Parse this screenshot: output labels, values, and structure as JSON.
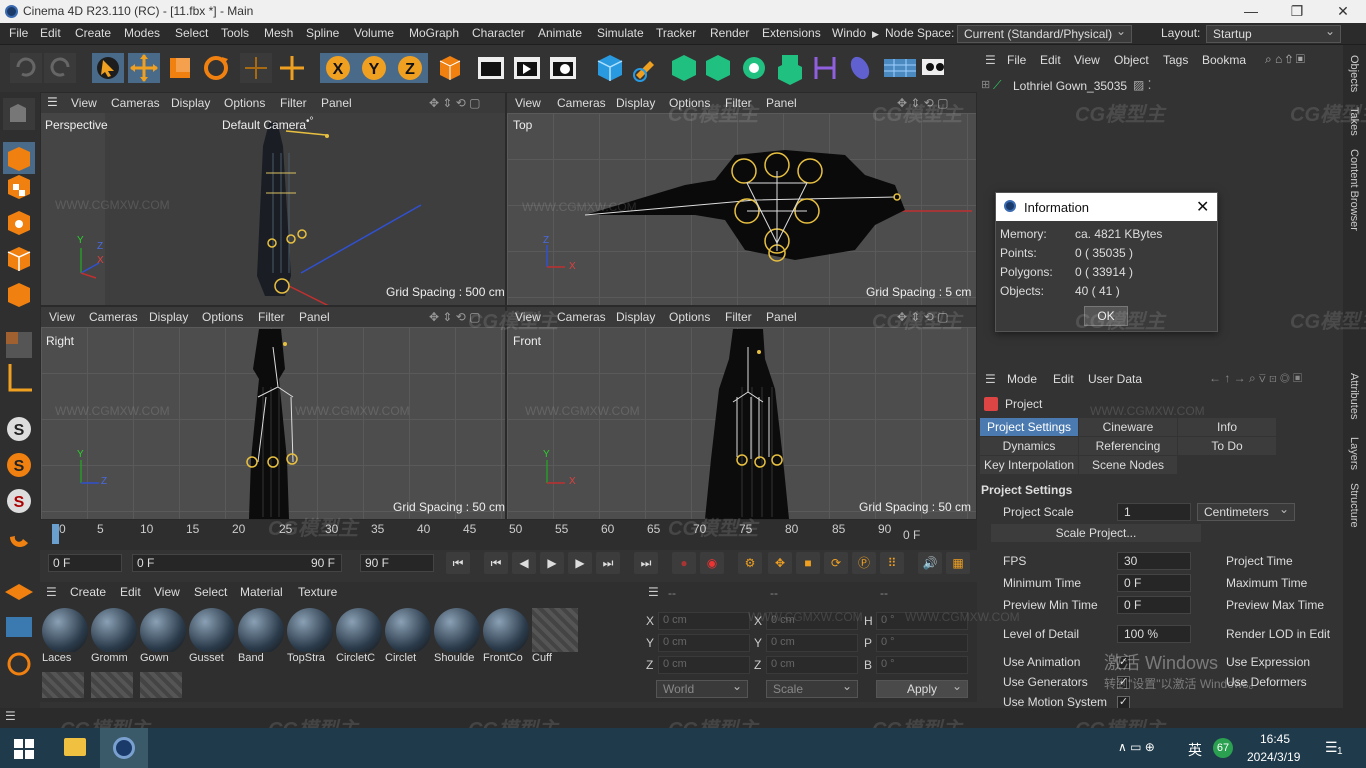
{
  "title_bar": {
    "title": "Cinema 4D R23.110 (RC) - [11.fbx *] - Main",
    "minimize": "—",
    "maximize": "❐",
    "close": "✕"
  },
  "menu": [
    "File",
    "Edit",
    "Create",
    "Modes",
    "Select",
    "Tools",
    "Mesh",
    "Spline",
    "Volume",
    "MoGraph",
    "Character",
    "Animate",
    "Simulate",
    "Tracker",
    "Render",
    "Extensions",
    "Windo"
  ],
  "node_space": {
    "label": "Node Space:",
    "value": "Current (Standard/Physical)"
  },
  "layout": {
    "label": "Layout:",
    "value": "Startup"
  },
  "viewport_menu": [
    "View",
    "Cameras",
    "Display",
    "Options",
    "Filter",
    "Panel"
  ],
  "viewports": {
    "perspective": {
      "name": "Perspective",
      "camera": "Default Camera",
      "camera_icon": "•°",
      "grid": "Grid Spacing : 500 cm"
    },
    "top": {
      "name": "Top",
      "grid": "Grid Spacing : 5 cm"
    },
    "right": {
      "name": "Right",
      "grid": "Grid Spacing : 50 cm"
    },
    "front": {
      "name": "Front",
      "grid": "Grid Spacing : 50 cm"
    }
  },
  "axis": {
    "x": "X",
    "y": "Y",
    "z": "Z"
  },
  "timeline": {
    "ticks": [
      "0",
      "5",
      "10",
      "15",
      "20",
      "25",
      "30",
      "35",
      "40",
      "45",
      "50",
      "55",
      "60",
      "65",
      "70",
      "75",
      "80",
      "85",
      "90"
    ],
    "end_label": "0 F"
  },
  "transport": {
    "current": "0 F",
    "range_start": "0 F",
    "range_end": "90 F",
    "max": "90 F"
  },
  "material_menu": [
    "Create",
    "Edit",
    "View",
    "Select",
    "Material",
    "Texture"
  ],
  "materials": [
    "Laces",
    "Gromm",
    "Gown",
    "Gusset",
    "Band",
    "TopStra",
    "CircletC",
    "Circlet",
    "Shoulde",
    "FrontCo",
    "Cuff"
  ],
  "coords": {
    "headers": [
      "--",
      "--",
      "--"
    ],
    "rows": [
      {
        "a": "X",
        "av": "0 cm",
        "b": "X",
        "bv": "0 cm",
        "c": "H",
        "cv": "0 °"
      },
      {
        "a": "Y",
        "av": "0 cm",
        "b": "Y",
        "bv": "0 cm",
        "c": "P",
        "cv": "0 °"
      },
      {
        "a": "Z",
        "av": "0 cm",
        "b": "Z",
        "bv": "0 cm",
        "c": "B",
        "cv": "0 °"
      }
    ],
    "world": "World",
    "scale": "Scale",
    "apply": "Apply"
  },
  "object_manager": {
    "menu": [
      "File",
      "Edit",
      "View",
      "Object",
      "Tags",
      "Bookma"
    ],
    "object": "Lothriel Gown_35035"
  },
  "info_dialog": {
    "title": "Information",
    "rows": [
      {
        "label": "Memory:",
        "value": "ca. 4821 KBytes"
      },
      {
        "label": "Points:",
        "value": "0 ( 35035 )"
      },
      {
        "label": "Polygons:",
        "value": "0 ( 33914 )"
      },
      {
        "label": "Objects:",
        "value": "40 ( 41 )"
      }
    ],
    "ok": "OK"
  },
  "attributes": {
    "menu": [
      "Mode",
      "Edit",
      "User Data"
    ],
    "header": "Project",
    "tabs": [
      [
        "Project Settings",
        "Cineware",
        "Info"
      ],
      [
        "Dynamics",
        "Referencing",
        "To Do"
      ],
      [
        "Key Interpolation",
        "Scene Nodes"
      ]
    ],
    "section": "Project Settings",
    "project_scale": {
      "label": "Project Scale",
      "value": "1",
      "unit": "Centimeters"
    },
    "scale_project": "Scale Project...",
    "fields": [
      {
        "label": "FPS",
        "value": "30",
        "right": "Project Time"
      },
      {
        "label": "Minimum Time",
        "value": "0 F",
        "right": "Maximum Time"
      },
      {
        "label": "Preview Min Time",
        "value": "0 F",
        "right": "Preview Max Time"
      },
      {
        "label": "Level of Detail",
        "value": "100 %",
        "right": "Render LOD in Edit"
      }
    ],
    "checks": [
      {
        "label": "Use Animation",
        "right": "Use Expression"
      },
      {
        "label": "Use Generators",
        "right": "Use Deformers"
      },
      {
        "label": "Use Motion System",
        "right": ""
      }
    ],
    "activate_overlay": [
      "激活 Windows",
      "转到\"设置\"以激活 Windows。"
    ]
  },
  "side_tabs": {
    "top": [
      "Objects",
      "Takes",
      "Content Browser"
    ],
    "bottom": [
      "Attributes",
      "Layers",
      "Structure"
    ]
  },
  "watermarks": {
    "brand": "CG模型主",
    "url": "WWW.CGMXW.COM"
  },
  "taskbar": {
    "ime": "英",
    "battery": "67",
    "time": "16:45",
    "date": "2024/3/19",
    "notify": "1"
  }
}
